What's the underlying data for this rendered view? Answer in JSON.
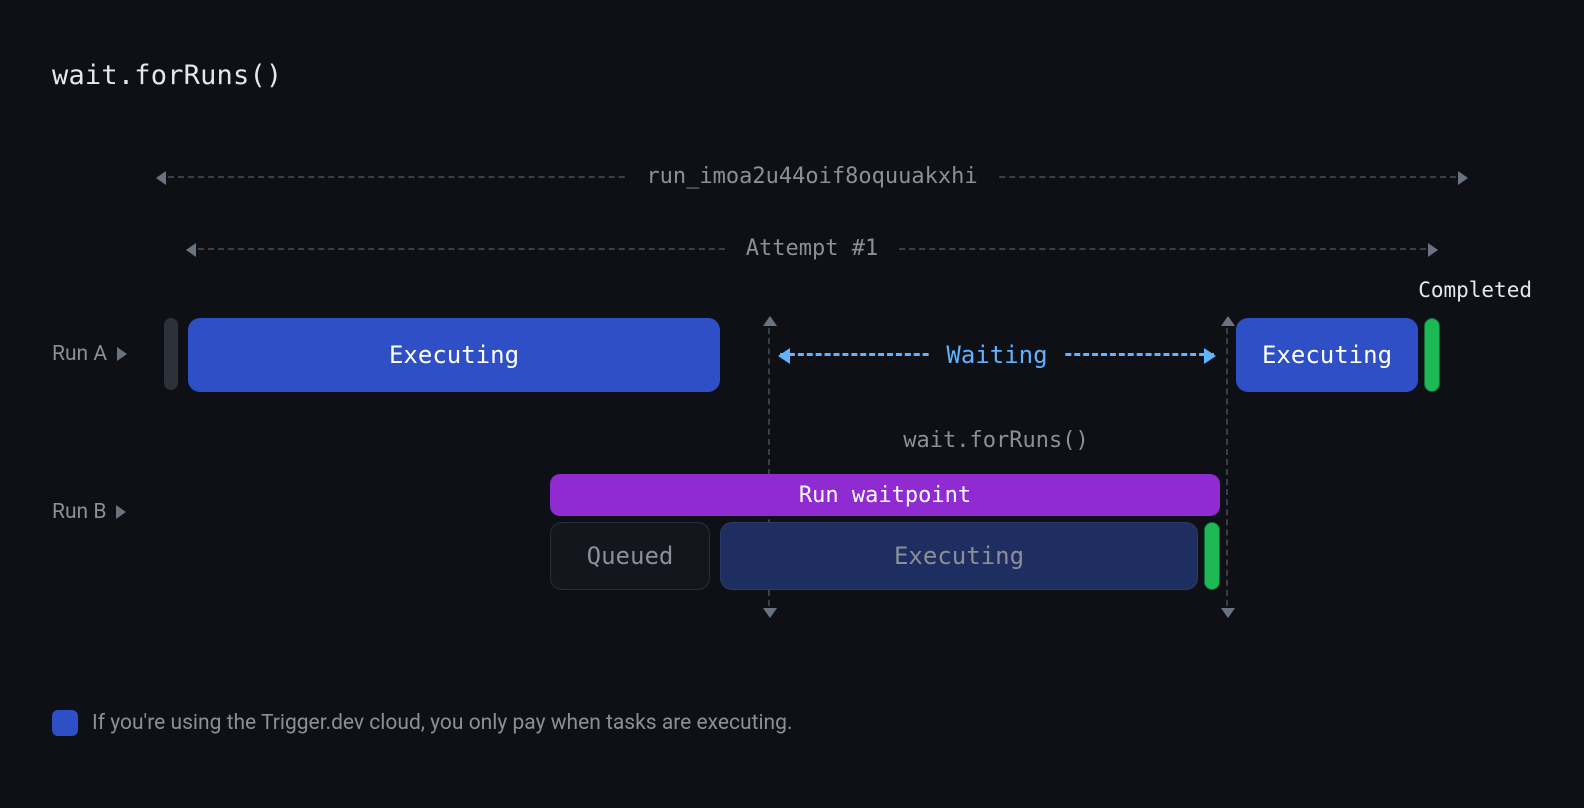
{
  "title": "wait.forRuns()",
  "spans": {
    "run_id": "run_imoa2u44oif8oquuakxhi",
    "attempt": "Attempt #1"
  },
  "rows": {
    "a": {
      "label": "Run A"
    },
    "b": {
      "label": "Run B"
    }
  },
  "blocks": {
    "a_exec1": "Executing",
    "a_wait": "Waiting",
    "a_exec2": "Executing",
    "waitpoint": "Run waitpoint",
    "b_queued": "Queued",
    "b_exec": "Executing"
  },
  "labels": {
    "completed": "Completed",
    "wfr": "wait.forRuns()"
  },
  "note": "If you're using the Trigger.dev cloud, you only pay when tasks are executing."
}
